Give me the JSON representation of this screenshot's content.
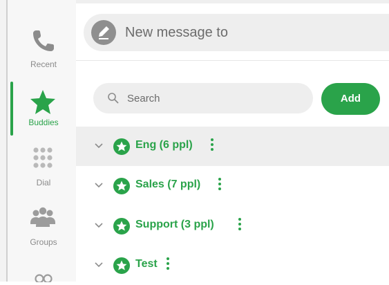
{
  "nav": {
    "items": [
      {
        "label": "Recent",
        "icon": "phone-icon",
        "active": false
      },
      {
        "label": "Buddies",
        "icon": "star-icon",
        "active": true
      },
      {
        "label": "Dial",
        "icon": "dialpad-icon",
        "active": false
      },
      {
        "label": "Groups",
        "icon": "groups-icon",
        "active": false
      }
    ]
  },
  "composer": {
    "placeholder": "New message to",
    "icon": "pencil-icon"
  },
  "search": {
    "placeholder": "Search",
    "icon": "search-icon"
  },
  "add_button": {
    "label": "Add"
  },
  "groups": [
    {
      "name": "Eng (6 ppl)",
      "selected": true
    },
    {
      "name": "Sales (7 ppl)",
      "selected": false
    },
    {
      "name": "Support (3 ppl)",
      "selected": false
    },
    {
      "name": "Test",
      "selected": false
    }
  ],
  "colors": {
    "accent": "#2aa34a",
    "sidebar_bg": "#f7f7f7",
    "selected_row": "#eeeeee",
    "muted_text": "#8a8a8a"
  }
}
